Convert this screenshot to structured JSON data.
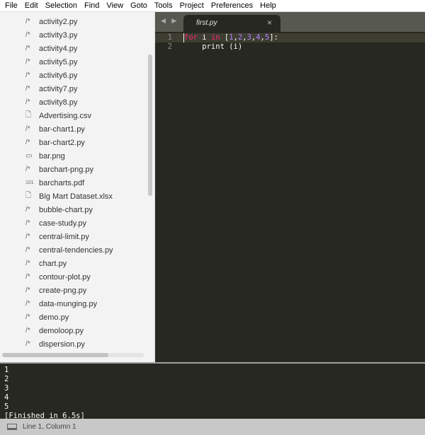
{
  "menu": [
    "File",
    "Edit",
    "Selection",
    "Find",
    "View",
    "Goto",
    "Tools",
    "Project",
    "Preferences",
    "Help"
  ],
  "sidebar": {
    "items": [
      {
        "icon": "code-file-icon",
        "glyph": "/*",
        "label": "activity2.py"
      },
      {
        "icon": "code-file-icon",
        "glyph": "/*",
        "label": "activity3.py"
      },
      {
        "icon": "code-file-icon",
        "glyph": "/*",
        "label": "activity4.py"
      },
      {
        "icon": "code-file-icon",
        "glyph": "/*",
        "label": "activity5.py"
      },
      {
        "icon": "code-file-icon",
        "glyph": "/*",
        "label": "activity6.py"
      },
      {
        "icon": "code-file-icon",
        "glyph": "/*",
        "label": "activity7.py"
      },
      {
        "icon": "code-file-icon",
        "glyph": "/*",
        "label": "activity8.py"
      },
      {
        "icon": "text-file-icon",
        "glyph": "🗋",
        "label": "Advertising.csv"
      },
      {
        "icon": "code-file-icon",
        "glyph": "/*",
        "label": "bar-chart1.py"
      },
      {
        "icon": "code-file-icon",
        "glyph": "/*",
        "label": "bar-chart2.py"
      },
      {
        "icon": "image-file-icon",
        "glyph": "▭",
        "label": "bar.png"
      },
      {
        "icon": "code-file-icon",
        "glyph": "/*",
        "label": "barchart-png.py"
      },
      {
        "icon": "binary-file-icon",
        "glyph": "101",
        "label": "barcharts.pdf"
      },
      {
        "icon": "text-file-icon",
        "glyph": "🗋",
        "label": "Big Mart Dataset.xlsx"
      },
      {
        "icon": "code-file-icon",
        "glyph": "/*",
        "label": "bubble-chart.py"
      },
      {
        "icon": "code-file-icon",
        "glyph": "/*",
        "label": "case-study.py"
      },
      {
        "icon": "code-file-icon",
        "glyph": "/*",
        "label": "central-limit.py"
      },
      {
        "icon": "code-file-icon",
        "glyph": "/*",
        "label": "central-tendencies.py"
      },
      {
        "icon": "code-file-icon",
        "glyph": "/*",
        "label": "chart.py"
      },
      {
        "icon": "code-file-icon",
        "glyph": "/*",
        "label": "contour-plot.py"
      },
      {
        "icon": "code-file-icon",
        "glyph": "/*",
        "label": "create-png.py"
      },
      {
        "icon": "code-file-icon",
        "glyph": "/*",
        "label": "data-munging.py"
      },
      {
        "icon": "code-file-icon",
        "glyph": "/*",
        "label": "demo.py"
      },
      {
        "icon": "code-file-icon",
        "glyph": "/*",
        "label": "demoloop.py"
      },
      {
        "icon": "code-file-icon",
        "glyph": "/*",
        "label": "dispersion.py"
      }
    ]
  },
  "tab": {
    "title": "first.py",
    "close": "×",
    "nav": "◀ ▶"
  },
  "code": {
    "lines": [
      {
        "n": "1"
      },
      {
        "n": "2",
        "text": "    print (i)"
      }
    ],
    "line1": {
      "kw1": "for",
      "a": " i ",
      "kw2": "in",
      "b": " [",
      "n1": "1",
      "n2": "2",
      "n3": "3",
      "n4": "4",
      "n5": "5",
      "c": "]:"
    }
  },
  "output": [
    "1",
    "2",
    "3",
    "4",
    "5",
    "[Finished in 6.5s]"
  ],
  "status": {
    "position": "Line 1, Column 1"
  }
}
